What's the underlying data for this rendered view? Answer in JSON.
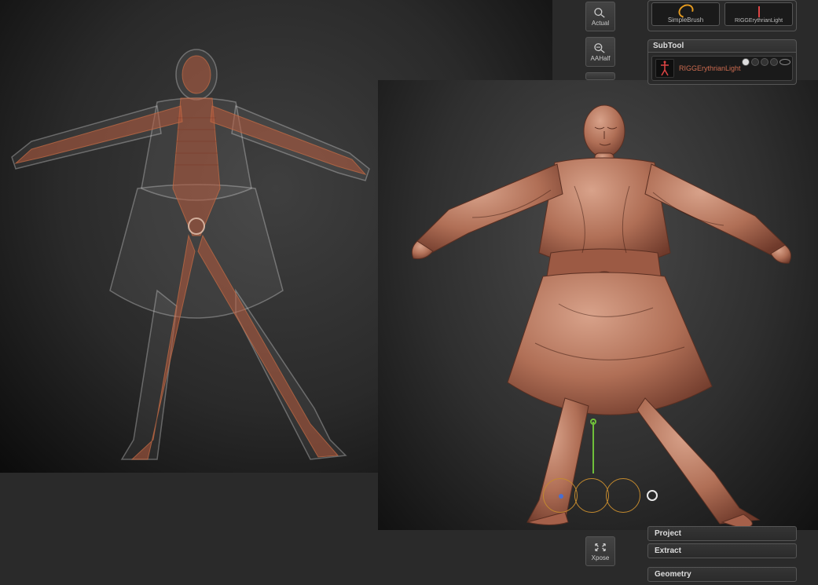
{
  "sidecol": {
    "actual": "Actual",
    "aahalf": "AAHalf",
    "xpose": "Xpose"
  },
  "brushes": {
    "simple": "SimpleBrush",
    "rigg": "RIGGErythrianLight"
  },
  "subtool": {
    "header": "SubTool",
    "item_name": "RIGGErythrianLight"
  },
  "rightbtns": {
    "project": "Project",
    "extract": "Extract",
    "geometry": "Geometry"
  }
}
